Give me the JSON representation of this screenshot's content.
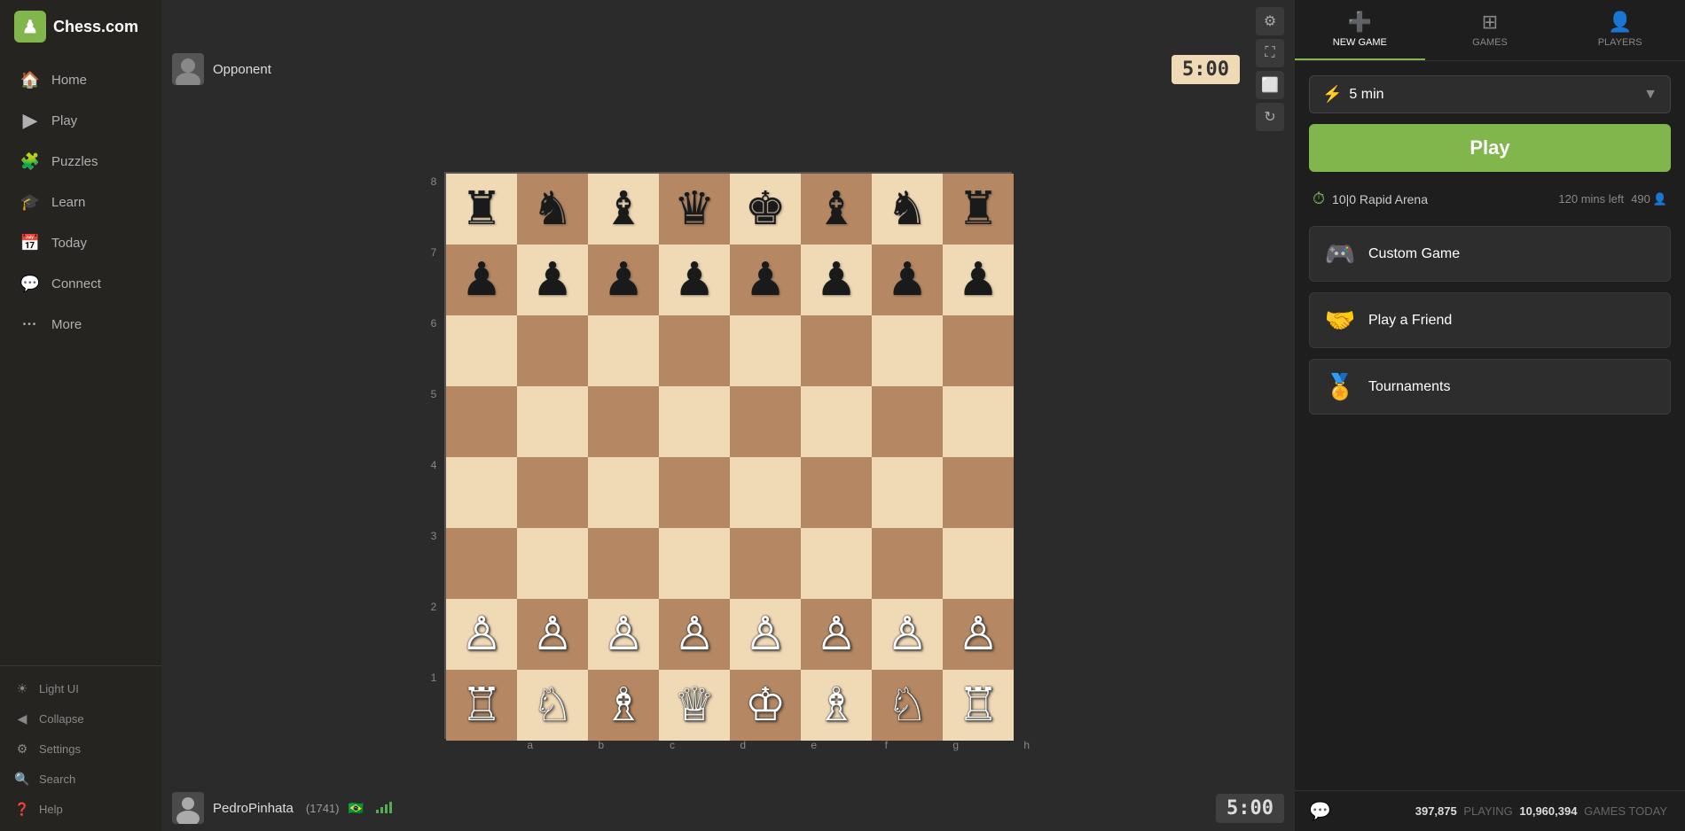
{
  "app": {
    "title": "Chess.com",
    "logo_text": "Chess.com"
  },
  "sidebar": {
    "nav_items": [
      {
        "id": "home",
        "label": "Home",
        "icon": "🏠"
      },
      {
        "id": "play",
        "label": "Play",
        "icon": "▶"
      },
      {
        "id": "puzzles",
        "label": "Puzzles",
        "icon": "🧩"
      },
      {
        "id": "learn",
        "label": "Learn",
        "icon": "🎓"
      },
      {
        "id": "today",
        "label": "Today",
        "icon": "📅"
      },
      {
        "id": "connect",
        "label": "Connect",
        "icon": "💬"
      },
      {
        "id": "more",
        "label": "More",
        "icon": "···"
      }
    ],
    "bottom_items": [
      {
        "id": "light-ui",
        "label": "Light UI",
        "icon": "☀"
      },
      {
        "id": "collapse",
        "label": "Collapse",
        "icon": "◀"
      },
      {
        "id": "settings",
        "label": "Settings",
        "icon": "⚙"
      },
      {
        "id": "search",
        "label": "Search",
        "icon": "🔍"
      },
      {
        "id": "help",
        "label": "Help",
        "icon": "?"
      }
    ]
  },
  "game": {
    "opponent_name": "Opponent",
    "opponent_timer": "5:00",
    "player_name": "PedroPinhata",
    "player_rating": "(1741)",
    "player_flag": "🇧🇷",
    "player_timer": "5:00",
    "rank_labels": [
      "8",
      "7",
      "6",
      "5",
      "4",
      "3",
      "2",
      "1"
    ],
    "file_labels": [
      "a",
      "b",
      "c",
      "d",
      "e",
      "f",
      "g",
      "h"
    ]
  },
  "board": {
    "rows": [
      [
        "♜",
        "♞",
        "♝",
        "♛",
        "♚",
        "♝",
        "♞",
        "♜"
      ],
      [
        "♟",
        "♟",
        "♟",
        "♟",
        "♟",
        "♟",
        "♟",
        "♟"
      ],
      [
        "",
        "",
        "",
        "",
        "",
        "",
        "",
        ""
      ],
      [
        "",
        "",
        "",
        "",
        "",
        "",
        "",
        ""
      ],
      [
        "",
        "",
        "",
        "",
        "",
        "",
        "",
        ""
      ],
      [
        "",
        "",
        "",
        "",
        "",
        "",
        "",
        ""
      ],
      [
        "♙",
        "♙",
        "♙",
        "♙",
        "♙",
        "♙",
        "♙",
        "♙"
      ],
      [
        "♖",
        "♘",
        "♗",
        "♕",
        "♔",
        "♗",
        "♘",
        "♖"
      ]
    ]
  },
  "right_panel": {
    "tabs": [
      {
        "id": "new-game",
        "label": "NEW GAME",
        "icon": "+"
      },
      {
        "id": "games",
        "label": "GAMES",
        "icon": "⊞"
      },
      {
        "id": "players",
        "label": "PLAYERS",
        "icon": "👤"
      }
    ],
    "active_tab": "new-game",
    "time_control": {
      "icon": "⚡",
      "value": "5 min"
    },
    "play_button_label": "Play",
    "arena": {
      "name": "10|0 Rapid Arena",
      "time_left": "120 mins left",
      "players": "490"
    },
    "action_buttons": [
      {
        "id": "custom-game",
        "icon": "🎮",
        "label": "Custom Game"
      },
      {
        "id": "play-friend",
        "icon": "🤝",
        "label": "Play a Friend"
      },
      {
        "id": "tournaments",
        "icon": "🏅",
        "label": "Tournaments"
      }
    ],
    "footer": {
      "playing_count": "397,875",
      "playing_label": "PLAYING",
      "games_today_count": "10,960,394",
      "games_today_label": "GAMES TODAY"
    }
  }
}
